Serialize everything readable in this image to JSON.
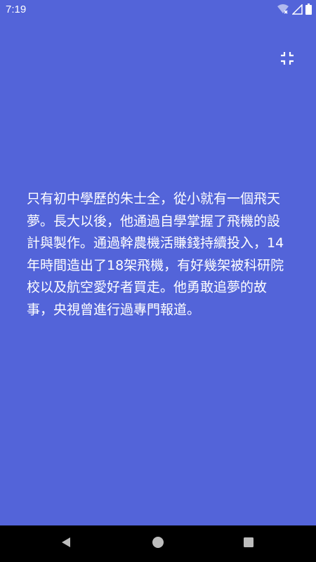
{
  "status_bar": {
    "time": "7:19",
    "icons": [
      "wifi-icon",
      "cellular-signal-icon",
      "battery-icon"
    ]
  },
  "toolbar": {
    "exit_fullscreen_icon": "fullscreen-exit-icon"
  },
  "content": {
    "text": "只有初中學歷的朱士全，從小就有一個飛天夢。長大以後，他通過自學掌握了飛機的設計與製作。通過幹農機活賺錢持續投入，14年時間造出了18架飛機，有好幾架被科研院校以及航空愛好者買走。他勇敢追夢的故事，央視曾進行過專門報道。"
  },
  "navigation": {
    "icons": [
      "back-icon",
      "home-icon",
      "recents-icon"
    ]
  },
  "colors": {
    "background": "#5364D9",
    "text": "#FFFFFF",
    "nav_bar": "#000000",
    "nav_icon": "#BDBDBD"
  }
}
